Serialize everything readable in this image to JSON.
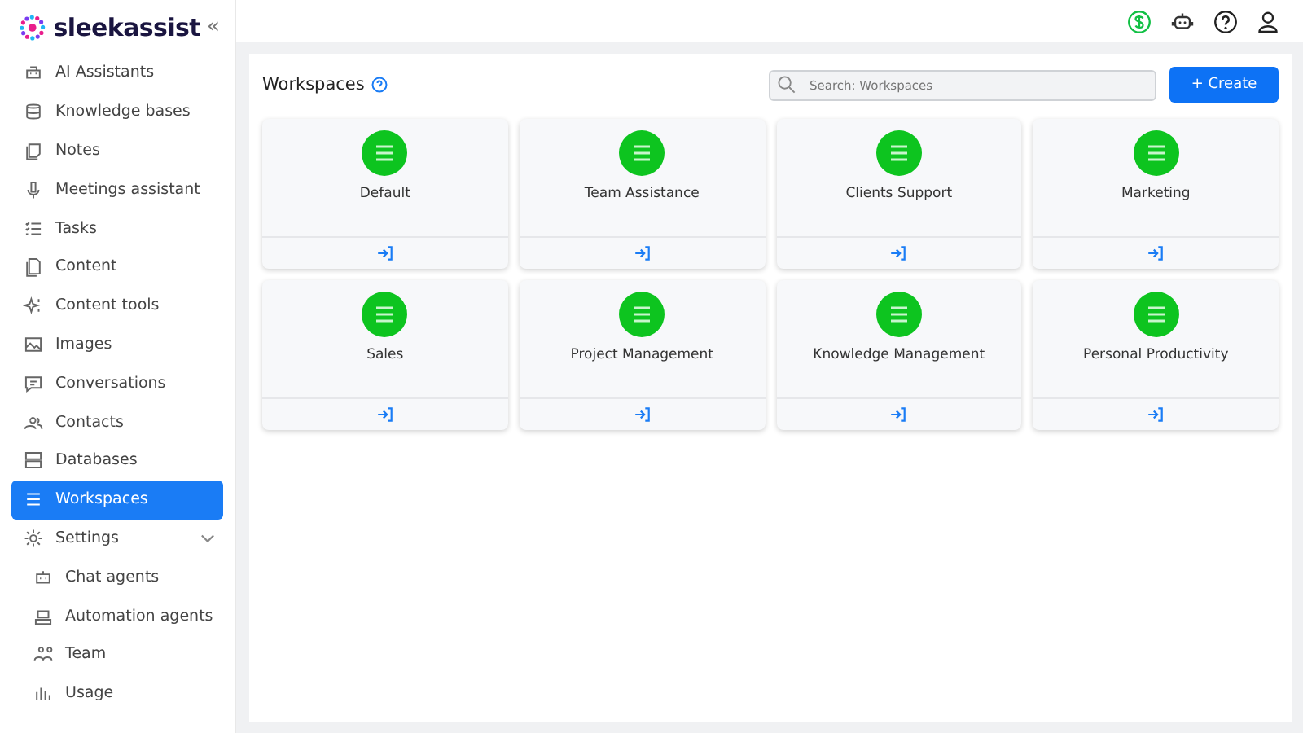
{
  "brand": {
    "name": "sleekassist",
    "collapse": "«"
  },
  "sidebar": {
    "items": [
      {
        "label": "AI Assistants",
        "selected": false
      },
      {
        "label": "Knowledge bases",
        "selected": false
      },
      {
        "label": "Notes",
        "selected": false
      },
      {
        "label": "Meetings assistant",
        "selected": false
      },
      {
        "label": "Tasks",
        "selected": false
      },
      {
        "label": "Content",
        "selected": false
      },
      {
        "label": "Content tools",
        "selected": false
      },
      {
        "label": "Images",
        "selected": false
      },
      {
        "label": "Conversations",
        "selected": false
      },
      {
        "label": "Contacts",
        "selected": false
      },
      {
        "label": "Databases",
        "selected": false
      },
      {
        "label": "Workspaces",
        "selected": true
      },
      {
        "label": "Settings",
        "selected": false,
        "expanded": true,
        "children": [
          {
            "label": "Chat agents",
            "selected": false
          },
          {
            "label": "Automation agents",
            "selected": false
          },
          {
            "label": "Team",
            "selected": false
          },
          {
            "label": "Usage",
            "selected": false
          }
        ]
      }
    ]
  },
  "page": {
    "title": "Workspaces",
    "search": {
      "placeholder": "Search: Workspaces"
    },
    "create_button": "+ Create"
  },
  "workspaces": [
    {
      "name": "Default"
    },
    {
      "name": "Team Assistance"
    },
    {
      "name": "Clients Support"
    },
    {
      "name": "Marketing"
    },
    {
      "name": "Sales"
    },
    {
      "name": "Project Management"
    },
    {
      "name": "Knowledge Management"
    },
    {
      "name": "Personal Productivity"
    }
  ]
}
